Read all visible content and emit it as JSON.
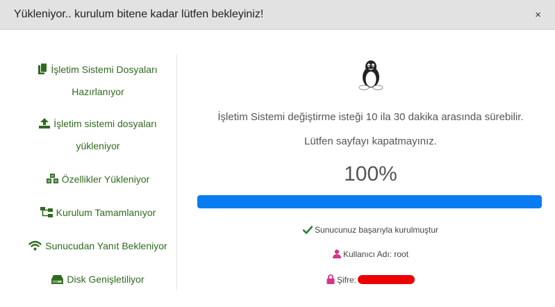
{
  "modal": {
    "title": "Yükleniyor.. kurulum bitene kadar lütfen bekleyiniz!",
    "close_glyph": "×"
  },
  "steps": [
    {
      "line1": "İşletim Sistemi Dosyaları",
      "line2": "Hazırlanıyor",
      "icon": "copy-icon"
    },
    {
      "line1": "İşletim sistemi dosyaları",
      "line2": "yükleniyor",
      "icon": "upload-icon"
    },
    {
      "line1": "Özellikler Yükleniyor",
      "icon": "cubes-icon"
    },
    {
      "line1": "Kurulum Tamamlanıyor",
      "icon": "sitemap-icon"
    },
    {
      "line1": "Sunucudan Yanıt Bekleniyor",
      "icon": "wifi-icon"
    },
    {
      "line1": "Disk Genişletiliyor",
      "icon": "hdd-icon"
    }
  ],
  "main": {
    "os_icon": "linux-tux-icon",
    "duration_message": "İşletim Sistemi değiştirme isteği 10 ila 30 dakika arasında sürebilir.",
    "keep_open_message": "Lütfen sayfayı kapatmayınız.",
    "percent_text": "100%",
    "progress_fraction": 1.0,
    "success_message": "Sunucunuz başarıyla kurulmuştur",
    "username_text": "Kullanıcı Adı: root",
    "password_label": "Şifre:"
  },
  "colors": {
    "step_text": "#2e6a1d",
    "progress_fill": "#0a7cf2",
    "success_check": "#2e7d32",
    "user_icon": "#d6338a",
    "redaction": "#ee0000"
  }
}
